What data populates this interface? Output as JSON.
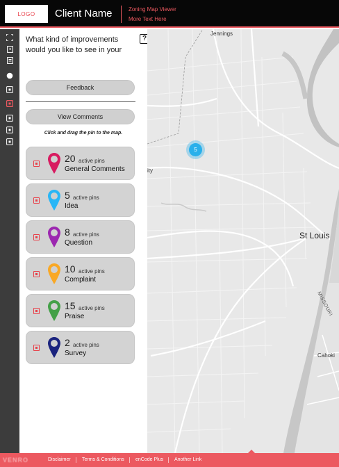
{
  "header": {
    "logo_text": "LOGO",
    "client_name": "Client Name",
    "subtitle_line1": "Zoning Map Viewer",
    "subtitle_line2": "More Text Here"
  },
  "toolbar": {
    "tools": [
      "fullscreen-icon",
      "layers-icon",
      "list-icon",
      "circle-icon",
      "comment-icon",
      "comment-active-icon",
      "comment-icon",
      "comment-icon",
      "comment-icon"
    ]
  },
  "panel": {
    "question": "What kind of improvements would you like to see in your",
    "help": "?",
    "feedback_label": "Feedback",
    "view_comments_label": "View Comments",
    "instruction": "Click and drag the pin to the map.",
    "categories": [
      {
        "count": "20",
        "active_label": "active pins",
        "name": "General Comments",
        "color": "#d81b60"
      },
      {
        "count": "5",
        "active_label": "active pins",
        "name": "Idea",
        "color": "#29b6f6"
      },
      {
        "count": "8",
        "active_label": "active pins",
        "name": "Question",
        "color": "#9c27b0"
      },
      {
        "count": "10",
        "active_label": "active pins",
        "name": "Complaint",
        "color": "#f9a825"
      },
      {
        "count": "15",
        "active_label": "active pins",
        "name": "Praise",
        "color": "#43a047"
      },
      {
        "count": "2",
        "active_label": "active pins",
        "name": "Survey",
        "color": "#1a237e"
      }
    ]
  },
  "map": {
    "labels": {
      "jennings": "Jennings",
      "city": "ity",
      "st_louis": "St Louis",
      "river": "MISSOURI",
      "cahokia": "Cahoki"
    },
    "cluster_count": "5"
  },
  "footer": {
    "brand": "VENRO",
    "links": [
      "Disclaimer",
      "Terms & Conditions",
      "enCode Plus",
      "Another Link"
    ]
  },
  "colors": {
    "accent": "#ec5960",
    "header_bg": "#070707",
    "toolbar_bg": "#3c3c3c",
    "cluster": "#29b0eb"
  }
}
